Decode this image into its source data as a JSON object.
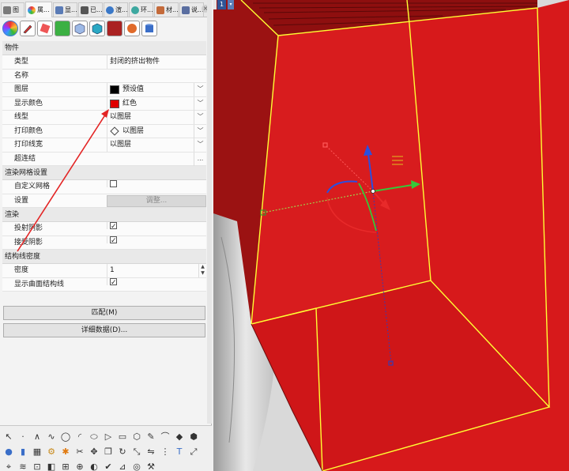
{
  "tabs": [
    {
      "label": "图",
      "icon": "layers-tab-icon",
      "color": "#7a7a7a"
    },
    {
      "label": "属...",
      "icon": "properties-tab-icon",
      "color": "#e05a2a"
    },
    {
      "label": "显...",
      "icon": "display-tab-icon",
      "color": "#5a7bb6"
    },
    {
      "label": "已...",
      "icon": "named-views-tab-icon",
      "color": "#555555"
    },
    {
      "label": "渲...",
      "icon": "render-tab-icon",
      "color": "#3a78c8"
    },
    {
      "label": "环...",
      "icon": "environment-tab-icon",
      "color": "#3da8a0"
    },
    {
      "label": "材...",
      "icon": "material-tab-icon",
      "color": "#c46a3a"
    },
    {
      "label": "说...",
      "icon": "help-tab-icon",
      "color": "#5a6ea0"
    }
  ],
  "properties": {
    "sections": {
      "object": "物件",
      "render_mesh": "渲染网格设置",
      "rendering": "渲染",
      "isocurve": "结构线密度"
    },
    "object_rows": [
      {
        "label": "类型",
        "value": "封闭的挤出物件"
      },
      {
        "label": "名称",
        "value": ""
      },
      {
        "label": "图层",
        "value": "预设值",
        "swatch": "#000000"
      },
      {
        "label": "显示颜色",
        "value": "红色",
        "swatch": "#e00000"
      },
      {
        "label": "线型",
        "value": "以图层"
      },
      {
        "label": "打印颜色",
        "value": "以图层"
      },
      {
        "label": "打印线宽",
        "value": "以图层"
      },
      {
        "label": "超连结",
        "value": "",
        "button": "..."
      }
    ],
    "mesh_rows": {
      "custom_mesh_label": "自定义网格",
      "custom_mesh_checked": false,
      "settings_label": "设置",
      "adjust_button": "调整..."
    },
    "render_rows": [
      {
        "label": "投射阴影",
        "checked": true
      },
      {
        "label": "接受阴影",
        "checked": true
      }
    ],
    "iso_rows": {
      "density_label": "密度",
      "density_value": "1",
      "show_label": "显示曲面结构线",
      "show_checked": true
    },
    "match_button": "匹配(M)",
    "details_button": "详细数据(D)..."
  },
  "viewport": {
    "label": "1",
    "object_color": "#d7191b",
    "highlight_color": "#ffff33"
  },
  "tab_close": "×"
}
